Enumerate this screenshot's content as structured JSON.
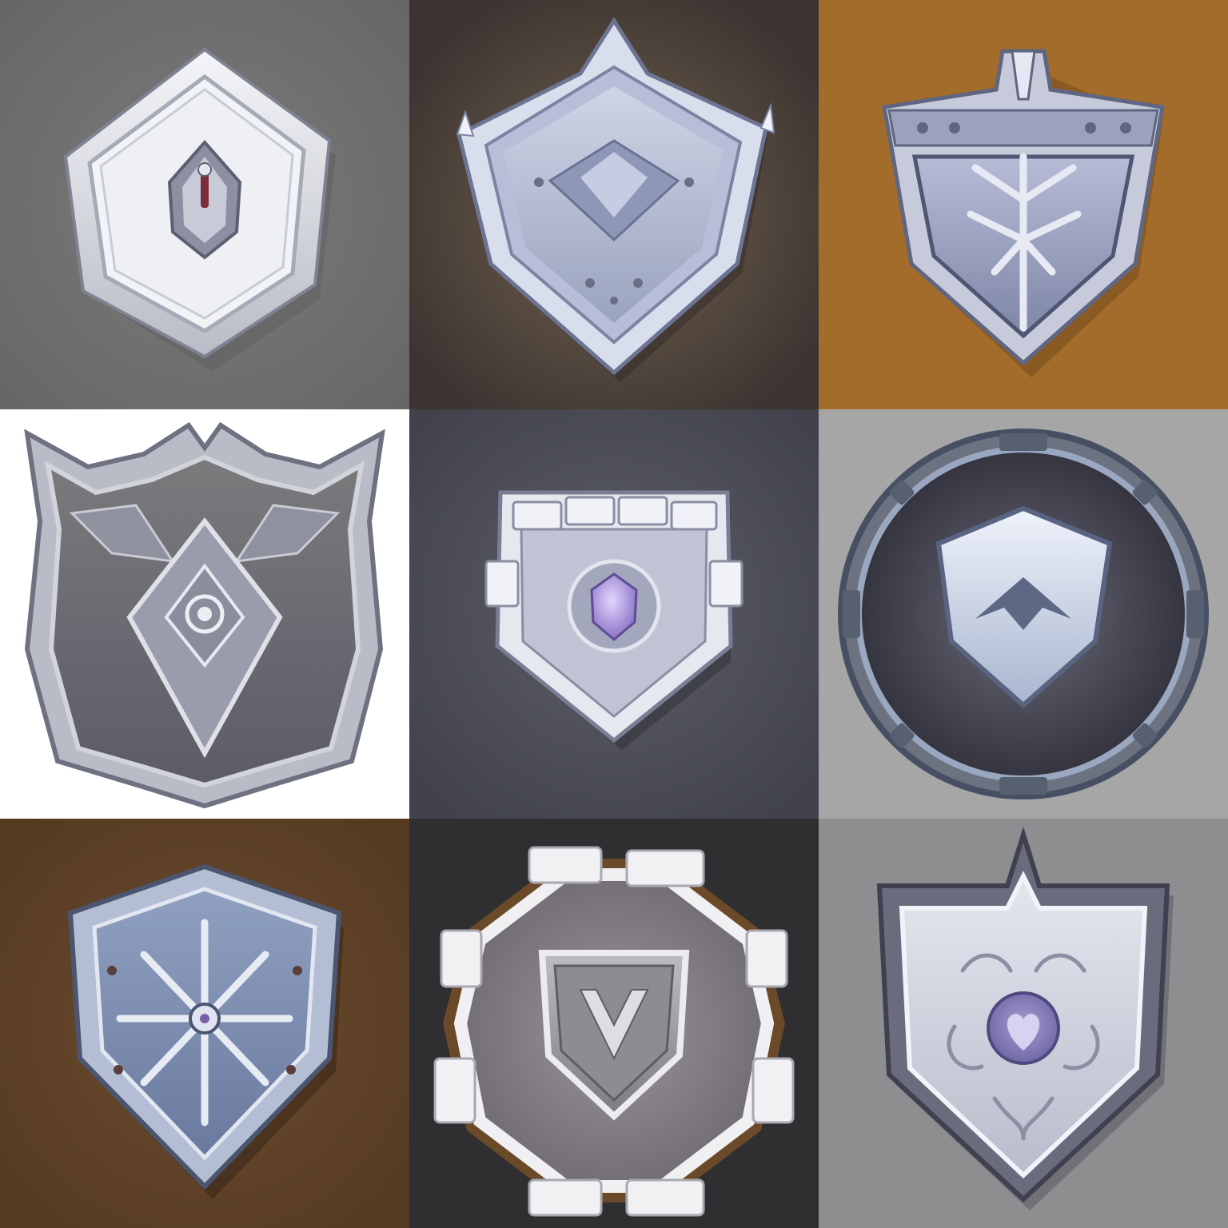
{
  "grid": {
    "rows": 3,
    "columns": 3,
    "cells": [
      {
        "id": "shield-1",
        "shape": "rounded-diamond-badge",
        "emblem": "gem-slit",
        "background": "#6e6e6e",
        "bg_center": "#7a7a7a"
      },
      {
        "id": "shield-2",
        "shape": "pointed-heater-shield",
        "emblem": "diamond-crest",
        "background": "#3c3633",
        "bg_center": "#6a5a4a"
      },
      {
        "id": "shield-3",
        "shape": "helm-crest-shield",
        "emblem": "tree-crack",
        "background": "#a06a28",
        "bg_center": "#a86f2b"
      },
      {
        "id": "shield-4",
        "shape": "wide-jagged-shield",
        "emblem": "eye-diamond",
        "background": "#ffffff",
        "bg_center": "#ffffff"
      },
      {
        "id": "shield-5",
        "shape": "stone-block-shield",
        "emblem": "purple-gem",
        "background": "#45464f",
        "bg_center": "#5a5b66"
      },
      {
        "id": "shield-6",
        "shape": "round-frame-with-shield",
        "emblem": "chevron-crest",
        "background": "#a5a5a5",
        "bg_center": "#ababab"
      },
      {
        "id": "shield-7",
        "shape": "kite-shield-rimmed",
        "emblem": "star-compass",
        "background": "#5b3e24",
        "bg_center": "#6b4b2e"
      },
      {
        "id": "shield-8",
        "shape": "octagon-frame-with-shield",
        "emblem": "rune-v",
        "background": "#2e2d2f",
        "bg_center": "#323134"
      },
      {
        "id": "shield-9",
        "shape": "ornate-heater-shield",
        "emblem": "heart-filigree",
        "background": "#8d8c8f",
        "bg_center": "#939296"
      }
    ]
  },
  "colors": {
    "steel_light": "#e4e6ee",
    "steel_mid": "#aeb2c2",
    "steel_dark": "#6d7288",
    "steel_deep": "#4a4e62",
    "gem_purple": "#9a86d6",
    "rivet": "#5a3e3a"
  }
}
